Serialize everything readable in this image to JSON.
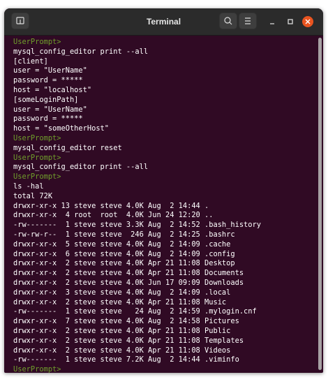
{
  "window": {
    "title": "Terminal",
    "accent_close": "#e95420"
  },
  "titlebar": {
    "buttons": [
      "new-tab",
      "search",
      "menu",
      "minimize",
      "maximize",
      "close"
    ]
  },
  "colors": {
    "background": "#300a24",
    "prompt": "#6f9e2b",
    "text": "#ffffff"
  },
  "terminal": {
    "lines": [
      {
        "t": "UserPrompt>",
        "p": true
      },
      {
        "t": "mysql_config_editor print --all"
      },
      {
        "t": "[client]"
      },
      {
        "t": "user = \"UserName\""
      },
      {
        "t": "password = *****"
      },
      {
        "t": "host = \"localhost\""
      },
      {
        "t": "[someLoginPath]"
      },
      {
        "t": "user = \"UserName\""
      },
      {
        "t": "password = *****"
      },
      {
        "t": "host = \"someOtherHost\""
      },
      {
        "t": "UserPrompt>",
        "p": true
      },
      {
        "t": "mysql_config_editor reset"
      },
      {
        "t": "UserPrompt>",
        "p": true
      },
      {
        "t": "mysql_config_editor print --all"
      },
      {
        "t": "UserPrompt>",
        "p": true
      },
      {
        "t": "ls -hal"
      },
      {
        "t": "total 72K"
      },
      {
        "t": "drwxr-xr-x 13 steve steve 4.0K Aug  2 14:44 ."
      },
      {
        "t": "drwxr-xr-x  4 root  root  4.0K Jun 24 12:20 .."
      },
      {
        "t": "-rw-------  1 steve steve 3.3K Aug  2 14:52 .bash_history"
      },
      {
        "t": "-rw-rw-r--  1 steve steve  246 Aug  2 14:25 .bashrc"
      },
      {
        "t": "drwxr-xr-x  5 steve steve 4.0K Aug  2 14:09 .cache"
      },
      {
        "t": "drwxr-xr-x  6 steve steve 4.0K Aug  2 14:09 .config"
      },
      {
        "t": "drwxr-xr-x  2 steve steve 4.0K Apr 21 11:08 Desktop"
      },
      {
        "t": "drwxr-xr-x  2 steve steve 4.0K Apr 21 11:08 Documents"
      },
      {
        "t": "drwxr-xr-x  2 steve steve 4.0K Jun 17 09:09 Downloads"
      },
      {
        "t": "drwxr-xr-x  3 steve steve 4.0K Aug  2 14:09 .local"
      },
      {
        "t": "drwxr-xr-x  2 steve steve 4.0K Apr 21 11:08 Music"
      },
      {
        "t": "-rw-------  1 steve steve   24 Aug  2 14:59 .mylogin.cnf"
      },
      {
        "t": "drwxr-xr-x  7 steve steve 4.0K Aug  2 14:58 Pictures"
      },
      {
        "t": "drwxr-xr-x  2 steve steve 4.0K Apr 21 11:08 Public"
      },
      {
        "t": "drwxr-xr-x  2 steve steve 4.0K Apr 21 11:08 Templates"
      },
      {
        "t": "drwxr-xr-x  2 steve steve 4.0K Apr 21 11:08 Videos"
      },
      {
        "t": "-rw-------  1 steve steve 7.2K Aug  2 14:44 .viminfo"
      },
      {
        "t": "UserPrompt>",
        "p": true
      }
    ]
  }
}
